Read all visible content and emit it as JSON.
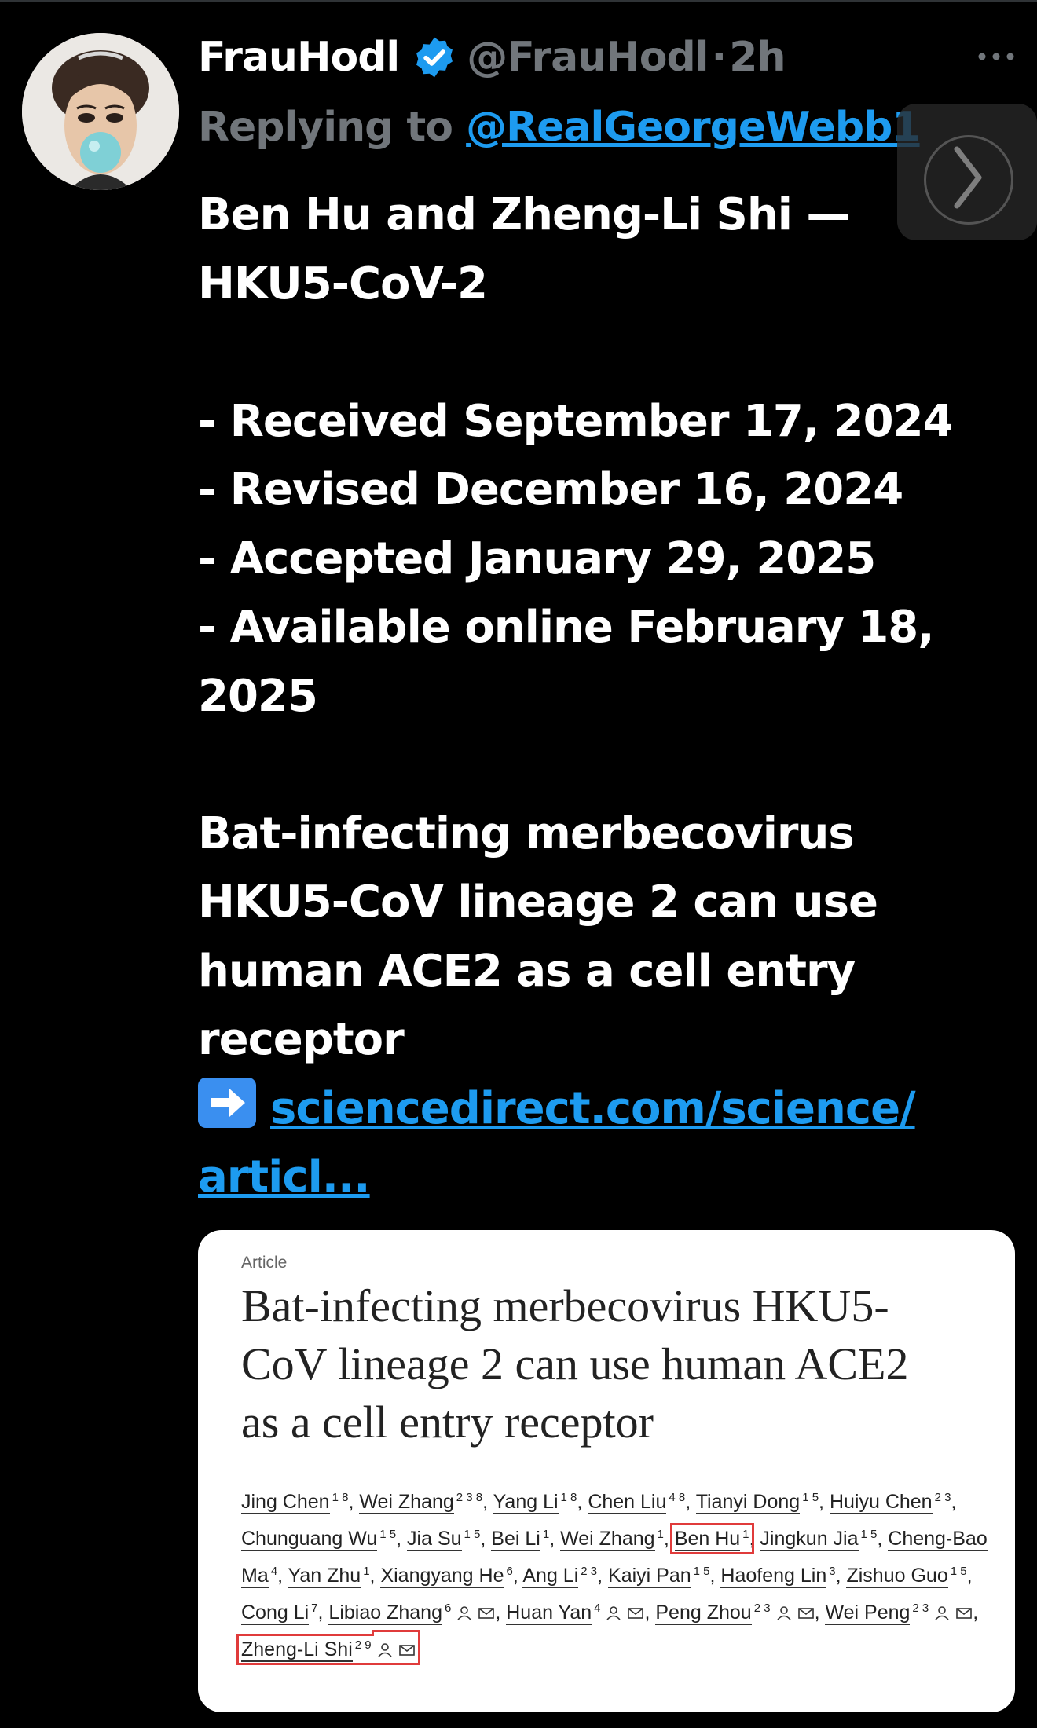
{
  "tweet": {
    "display_name": "FrauHodl",
    "handle": "@FrauHodl",
    "separator": "·",
    "time": "2h",
    "verified_icon": "verified-badge-icon",
    "more_icon": "more-horizontal-icon",
    "reply_prefix": "Replying to",
    "reply_handle": "@RealGeorgeWebb1",
    "lines": [
      "Ben Hu and Zheng-Li Shi —",
      "HKU5-CoV-2",
      "",
      "- Received September 17, 2024",
      "- Revised December 16, 2024",
      "- Accepted January 29, 2025",
      "- Available online February 18,",
      "2025",
      "",
      "Bat-infecting merbecovirus",
      "HKU5-CoV lineage 2 can use",
      "human ACE2 as a cell entry",
      "receptor"
    ],
    "link_emoji": "right-arrow-emoji-icon",
    "link_line1": "sciencedirect.com/science/",
    "link_line2": "articl..."
  },
  "card": {
    "label": "Article",
    "title_lines": [
      "Bat-infecting merbecovirus HKU5-",
      "CoV lineage 2 can use human ACE2",
      "as a cell entry receptor"
    ],
    "authors": [
      {
        "name": "Jing Chen",
        "sup": "1 8"
      },
      {
        "name": "Wei Zhang",
        "sup": "2 3 8"
      },
      {
        "name": "Yang Li",
        "sup": "1 8"
      },
      {
        "name": "Chen Liu",
        "sup": "4 8"
      },
      {
        "name": "Tianyi Dong",
        "sup": "1 5"
      },
      {
        "name": "Huiyu Chen",
        "sup": "2 3"
      },
      {
        "name": "Chunguang Wu",
        "sup": "1 5"
      },
      {
        "name": "Jia Su",
        "sup": "1 5"
      },
      {
        "name": "Bei Li",
        "sup": "1"
      },
      {
        "name": "Wei Zhang",
        "sup": "1"
      },
      {
        "name": "Ben Hu",
        "sup": "1",
        "highlight": true
      },
      {
        "name": "Jingkun Jia",
        "sup": "1 5"
      },
      {
        "name": "Cheng-Bao Ma",
        "sup": "4"
      },
      {
        "name": "Yan Zhu",
        "sup": "1"
      },
      {
        "name": "Xiangyang He",
        "sup": "6"
      },
      {
        "name": "Ang Li",
        "sup": "2 3"
      },
      {
        "name": "Kaiyi Pan",
        "sup": "1 5"
      },
      {
        "name": "Haofeng Lin",
        "sup": "3"
      },
      {
        "name": "Zishuo Guo",
        "sup": "1 5"
      },
      {
        "name": "Cong Li",
        "sup": "7"
      },
      {
        "name": "Libiao Zhang",
        "sup": "6",
        "corresponding": true
      },
      {
        "name": "Huan Yan",
        "sup": "4",
        "corresponding": true
      },
      {
        "name": "Peng Zhou",
        "sup": "2 3",
        "corresponding": true
      },
      {
        "name": "Wei Peng",
        "sup": "2 3",
        "corresponding": true
      },
      {
        "name": "Zheng-Li Shi",
        "sup": "2 9",
        "corresponding": true,
        "highlight": true
      }
    ],
    "highlight_color": "#e03b3b"
  },
  "colors": {
    "background": "#000000",
    "link": "#1d9bf0",
    "muted": "#71767b",
    "verified": "#1d9bf0"
  }
}
